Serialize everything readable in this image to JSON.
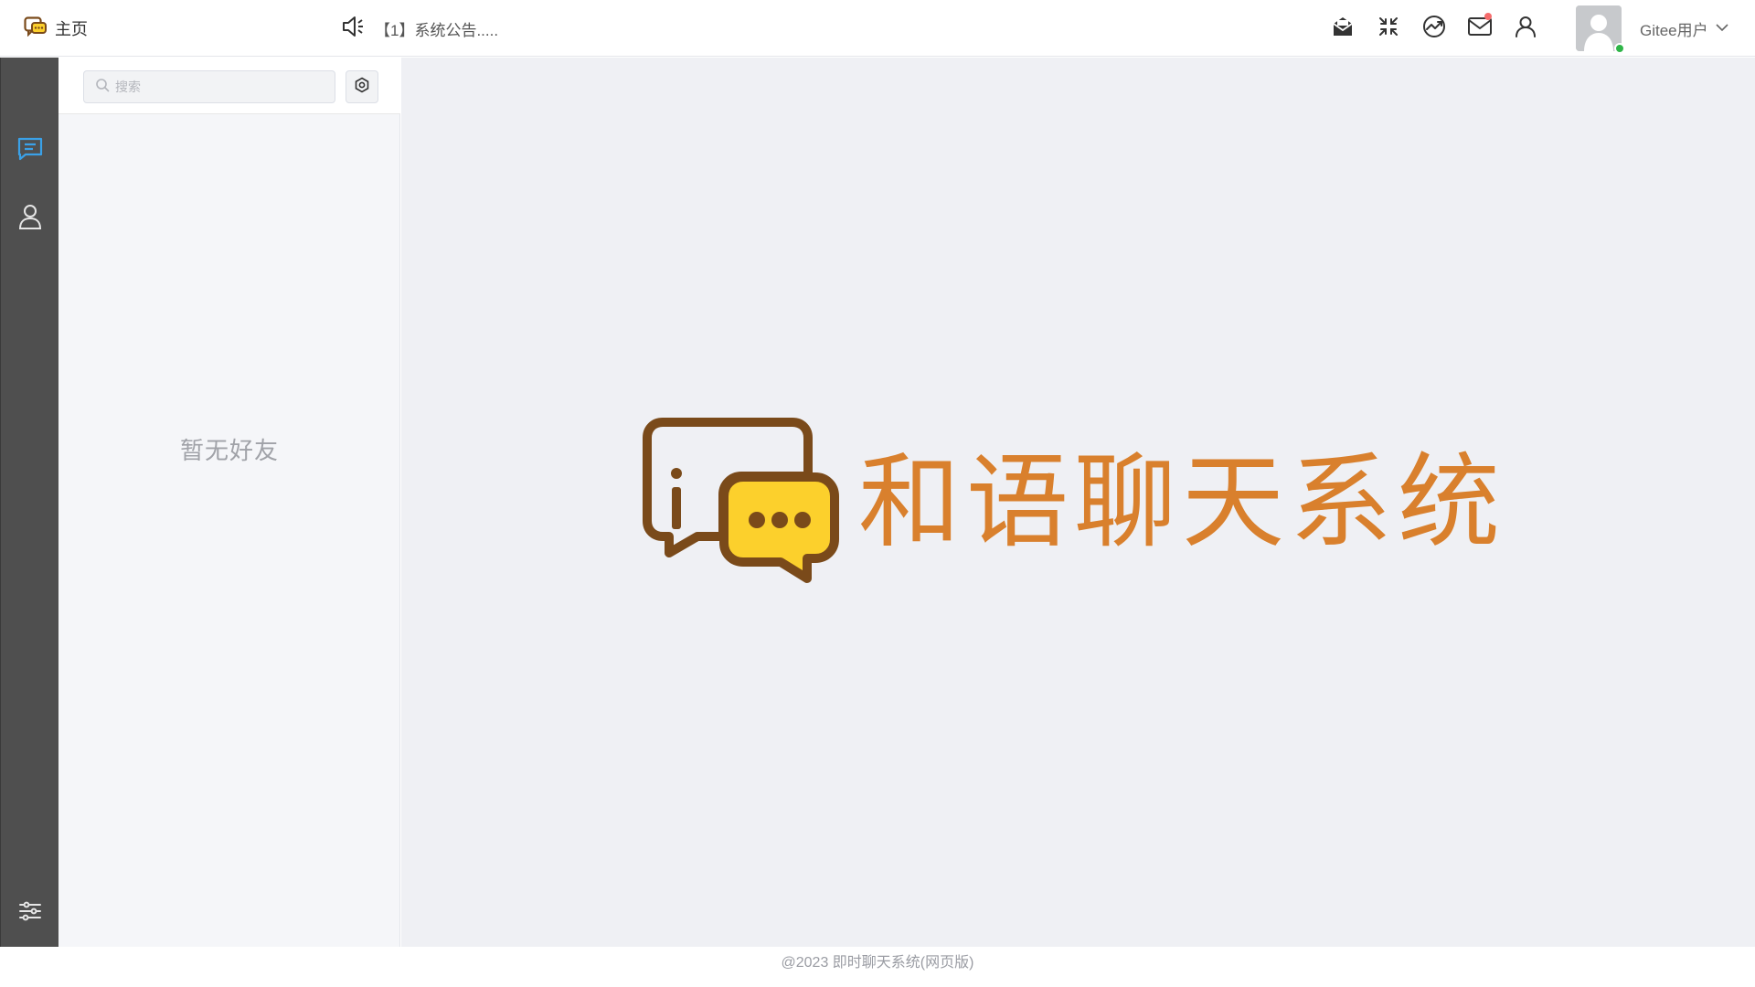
{
  "header": {
    "home_label": "主页",
    "notice_text": "【1】系统公告.....",
    "actions": [
      {
        "name": "mail-open-icon",
        "badge": false
      },
      {
        "name": "shrink-icon",
        "badge": false
      },
      {
        "name": "chart-icon",
        "badge": false
      },
      {
        "name": "mail-icon",
        "badge": true
      },
      {
        "name": "user-icon",
        "badge": false
      }
    ],
    "user_name": "Gitee用户",
    "online_status_color": "#2fb548"
  },
  "sidebar": {
    "items": [
      {
        "name": "chat-icon",
        "active": true
      },
      {
        "name": "contacts-icon",
        "active": false
      }
    ],
    "bottom": {
      "name": "settings-sliders-icon"
    },
    "active_color": "#3aa1e8"
  },
  "friends": {
    "search_placeholder": "搜索",
    "empty_text": "暂无好友"
  },
  "main": {
    "brand_title": "和语聊天系统",
    "brand_color": "#d9802d"
  },
  "footer": {
    "text": "@2023 即时聊天系统(网页版)"
  }
}
